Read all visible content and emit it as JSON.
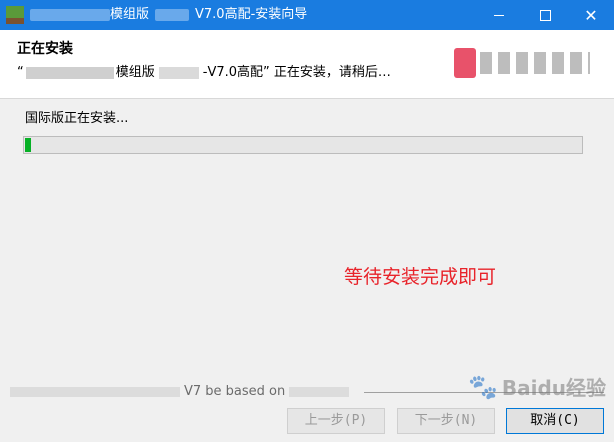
{
  "window": {
    "title_part1": "模组版",
    "title_part2": "V7.0高配-安装向导",
    "minimize_label": "—",
    "maximize_label": "□",
    "close_label": "✕"
  },
  "header": {
    "title": "正在安装",
    "subtitle_open": "“",
    "subtitle_part1": "模组版",
    "subtitle_part2": "-V7.0高配” 正在安装，请稍后…"
  },
  "install": {
    "status_text": "国际版正在安装...",
    "progress": 0.01
  },
  "annotation": "等待安装完成即可",
  "footer": {
    "based_on": "V7 be based on",
    "back_button": "上一步(P)",
    "next_button": "下一步(N)",
    "cancel_button": "取消(C)"
  },
  "watermark": "Baidu经验",
  "colors": {
    "titlebar": "#1a7ce0",
    "progress_fill": "#06b025",
    "annotation": "#e8232a"
  }
}
